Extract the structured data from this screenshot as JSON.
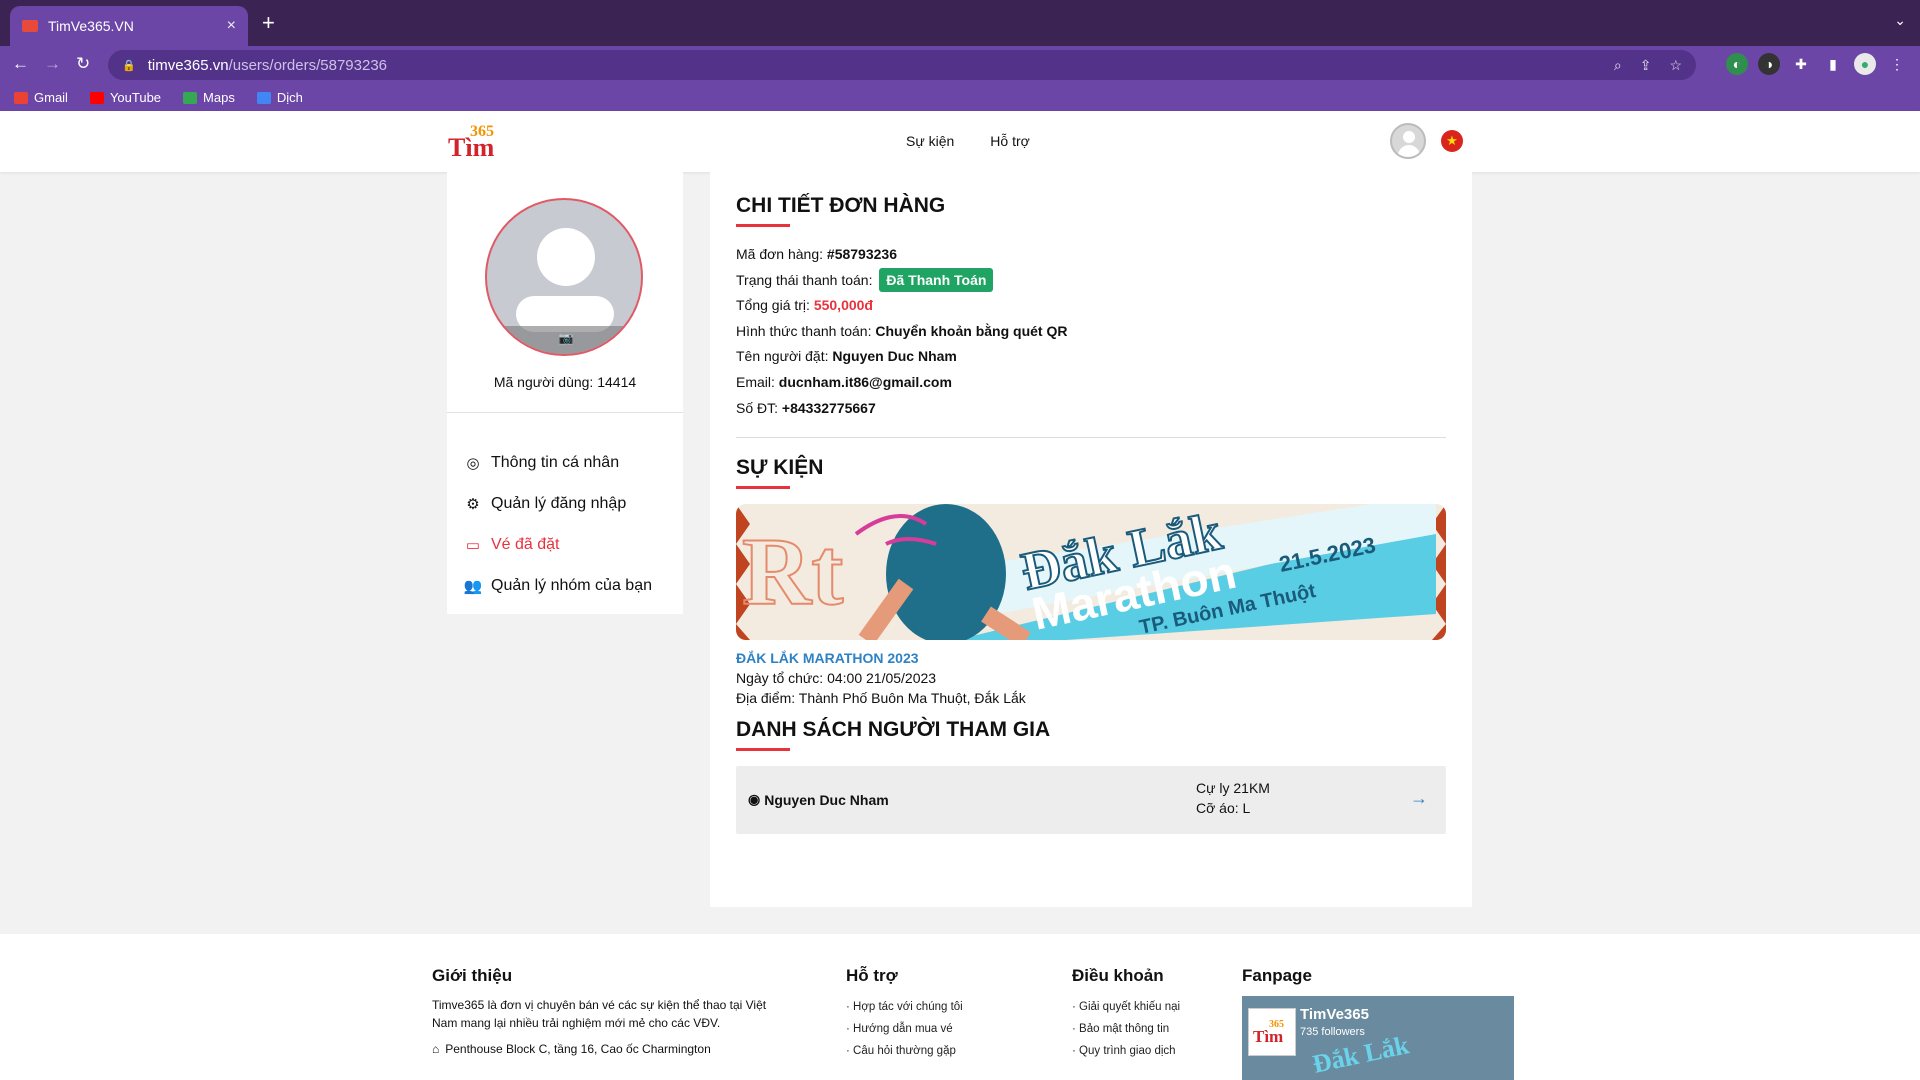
{
  "browser": {
    "tab_title": "TimVe365.VN",
    "tab_close": "×",
    "new_tab": "+",
    "tab_menu": "⌄",
    "url_domain": "timve365.vn",
    "url_path": "/users/orders/58793236",
    "bookmarks": [
      {
        "label": "Gmail",
        "icon": "gmail-icon",
        "color": "#ea4335"
      },
      {
        "label": "YouTube",
        "icon": "youtube-icon",
        "color": "#ff0000"
      },
      {
        "label": "Maps",
        "icon": "maps-icon",
        "color": "#34a853"
      },
      {
        "label": "Dịch",
        "icon": "translate-icon",
        "color": "#4285f4"
      }
    ]
  },
  "site": {
    "logo_main": "Tìm",
    "logo_sub": "365",
    "nav": [
      "Sự kiện",
      "Hỗ trợ"
    ],
    "flag_star": "★"
  },
  "sidebar": {
    "user_id": "Mã người dùng: 14414",
    "menu": [
      {
        "label": "Thông tin cá nhân",
        "icon": "user-circle-icon",
        "active": false
      },
      {
        "label": "Quản lý đăng nhập",
        "icon": "user-cog-icon",
        "active": false
      },
      {
        "label": "Vé đã đặt",
        "icon": "ticket-icon",
        "active": true
      },
      {
        "label": "Quản lý nhóm của bạn",
        "icon": "users-icon",
        "active": false
      }
    ]
  },
  "order": {
    "heading": "CHI TIẾT ĐƠN HÀNG",
    "code_label": "Mã đơn hàng: ",
    "code_value": "#58793236",
    "status_label": "Trạng thái thanh toán: ",
    "status_value": "Đã Thanh Toán",
    "total_label": "Tổng giá trị: ",
    "total_value": "550,000đ",
    "method_label": "Hình thức thanh toán: ",
    "method_value": "Chuyển khoản bằng quét QR",
    "name_label": "Tên người đặt: ",
    "name_value": "Nguyen Duc Nham",
    "email_label": "Email: ",
    "email_value": "ducnham.it86@gmail.com",
    "phone_label": "Số ĐT: ",
    "phone_value": "+84332775667"
  },
  "event": {
    "heading": "SỰ KIỆN",
    "banner_text_1": "Đắk Lắk",
    "banner_text_2": "Marathon",
    "banner_date": "21.5.2023",
    "banner_city": "TP. Buôn Ma Thuột",
    "name": "ĐẮK LẮK MARATHON 2023",
    "date": "Ngày tổ chức: 04:00 21/05/2023",
    "location": "Địa điểm: Thành Phố Buôn Ma Thuột, Đắk Lắk"
  },
  "participants": {
    "heading": "DANH SÁCH NGƯỜI THAM GIA",
    "items": [
      {
        "name": "Nguyen Duc Nham",
        "distance": "Cự ly 21KM",
        "shirt": "Cỡ áo: L"
      }
    ]
  },
  "footer": {
    "intro_title": "Giới thiệu",
    "intro_text": "Timve365 là đơn vị chuyên bán vé các sự kiện thể thao tại Việt Nam mang lại nhiều trải nghiệm mới mẻ cho các VĐV.",
    "address": "Penthouse Block C, tầng 16, Cao ốc Charmington",
    "support_title": "Hỗ trợ",
    "support_links": [
      "Hợp tác với chúng tôi",
      "Hướng dẫn mua vé",
      "Câu hỏi thường gặp"
    ],
    "terms_title": "Điều khoản",
    "terms_links": [
      "Giải quyết khiếu nại",
      "Bảo mật thông tin",
      "Quy trình giao dịch"
    ],
    "fanpage_title": "Fanpage",
    "fanpage_name": "TimVe365",
    "fanpage_followers": "735 followers",
    "fanpage_banner": "Đắk Lắk"
  },
  "colors": {
    "accent": "#e8323c",
    "paid_badge": "#1fa463",
    "link_blue": "#2e82c4",
    "browser_purple": "#6c46a7"
  }
}
